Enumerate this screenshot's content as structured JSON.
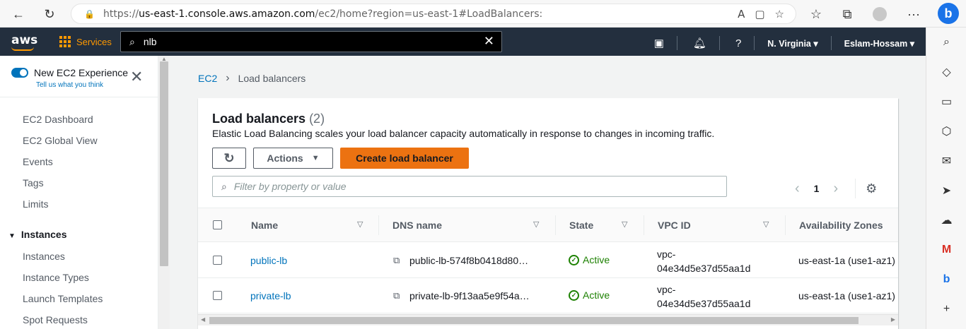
{
  "browser": {
    "url_prefix": "https://",
    "url_host": "us-east-1.console.aws.amazon.com",
    "url_rest": "/ec2/home?region=us-east-1#LoadBalancers:"
  },
  "aws": {
    "logo": "aws",
    "services_label": "Services",
    "search_value": "nlb",
    "region": "N. Virginia",
    "user": "Eslam-Hossam"
  },
  "sidebar": {
    "toggle_label": "New EC2 Experience",
    "feedback_link": "Tell us what you think",
    "items": [
      "EC2 Dashboard",
      "EC2 Global View",
      "Events",
      "Tags",
      "Limits"
    ],
    "section": "Instances",
    "section_items": [
      "Instances",
      "Instance Types",
      "Launch Templates",
      "Spot Requests"
    ]
  },
  "breadcrumb": {
    "root": "EC2",
    "current": "Load balancers"
  },
  "panel": {
    "title": "Load balancers",
    "count": "(2)",
    "description": "Elastic Load Balancing scales your load balancer capacity automatically in response to changes in incoming traffic.",
    "actions_label": "Actions",
    "create_label": "Create load balancer",
    "filter_placeholder": "Filter by property or value",
    "page": "1"
  },
  "table": {
    "headers": [
      "Name",
      "DNS name",
      "State",
      "VPC ID",
      "Availability Zones"
    ],
    "rows": [
      {
        "name": "public-lb",
        "dns": "public-lb-574f8b0418d80…",
        "state": "Active",
        "vpc_line1": "vpc-",
        "vpc_line2": "04e34d5e37d55aa1d",
        "az": "us-east-1a (use1-az1)"
      },
      {
        "name": "private-lb",
        "dns": "private-lb-9f13aa5e9f54a…",
        "state": "Active",
        "vpc_line1": "vpc-",
        "vpc_line2": "04e34d5e37d55aa1d",
        "az": "us-east-1a (use1-az1)"
      }
    ]
  },
  "colors": {
    "aws_nav": "#232f3e",
    "accent_orange": "#ec7211",
    "link_blue": "#0073bb",
    "success_green": "#1d8102"
  }
}
